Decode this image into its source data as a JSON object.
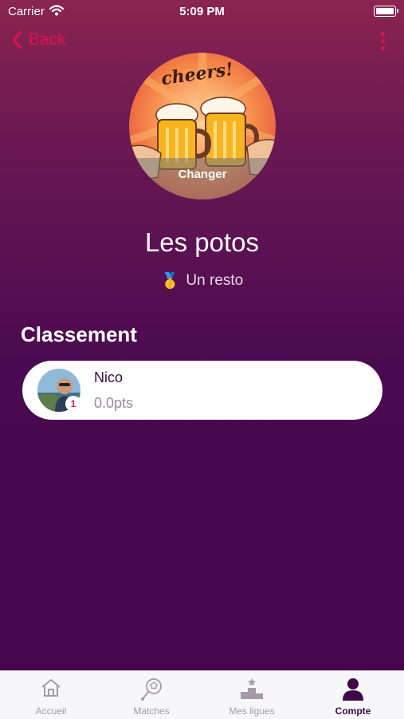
{
  "status_bar": {
    "carrier": "Carrier",
    "time": "5:09 PM"
  },
  "nav": {
    "back_label": "Back"
  },
  "league": {
    "image_text": "cheers!",
    "change_label": "Changer",
    "name": "Les potos",
    "prize_emoji": "🥇",
    "prize": "Un resto"
  },
  "ranking": {
    "title": "Classement",
    "entries": [
      {
        "rank": "1",
        "name": "Nico",
        "points": "0.0pts"
      }
    ]
  },
  "tabbar": {
    "tabs": [
      {
        "label": "Accueil",
        "icon": "home-icon"
      },
      {
        "label": "Matches",
        "icon": "soccer-ball-icon"
      },
      {
        "label": "Mes ligues",
        "icon": "podium-icon"
      },
      {
        "label": "Compte",
        "icon": "user-icon",
        "active": true
      }
    ]
  },
  "colors": {
    "accent": "#e0104f",
    "active_tab": "#3d0a47",
    "inactive_tab": "#a49ca8"
  }
}
